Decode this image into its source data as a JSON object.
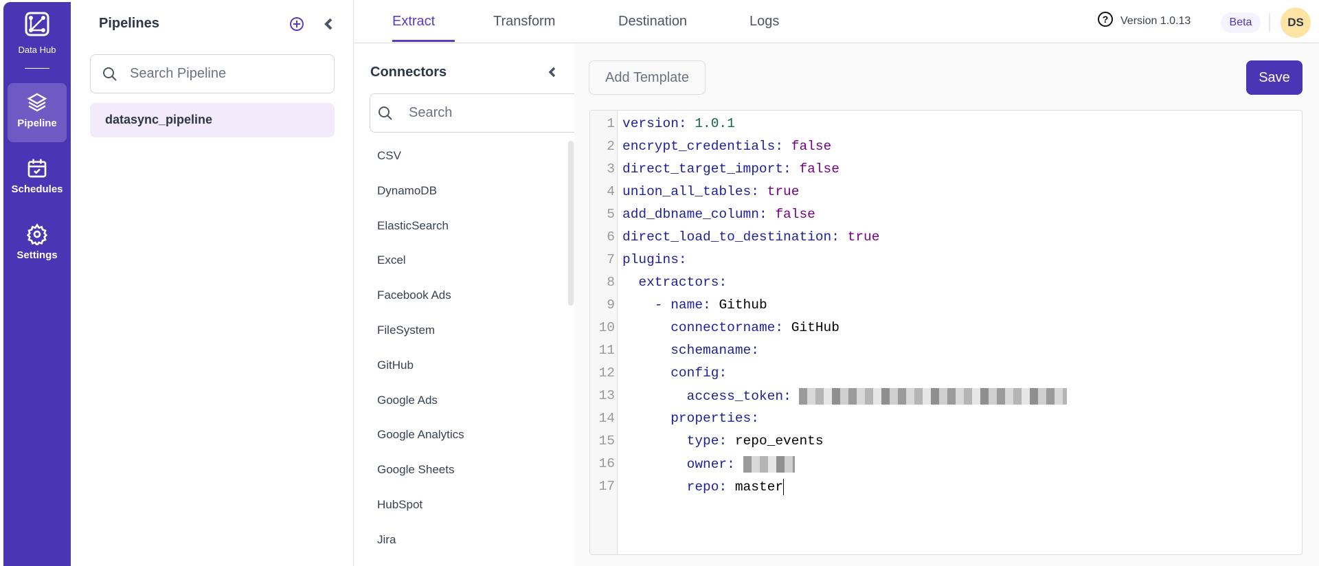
{
  "app": {
    "brand": "Data Hub"
  },
  "rail": [
    {
      "label": "Pipeline",
      "icon": "layers-icon"
    },
    {
      "label": "Schedules",
      "icon": "calendar-check-icon"
    },
    {
      "label": "Settings",
      "icon": "gear-icon"
    }
  ],
  "pipelines": {
    "title": "Pipelines",
    "search_placeholder": "Search Pipeline",
    "items": [
      "datasync_pipeline"
    ]
  },
  "tabs": [
    "Extract",
    "Transform",
    "Destination",
    "Logs"
  ],
  "header": {
    "version": "Version 1.0.13",
    "badge": "Beta",
    "avatar": "DS"
  },
  "connectors": {
    "title": "Connectors",
    "search_placeholder": "Search",
    "items": [
      "CSV",
      "DynamoDB",
      "ElasticSearch",
      "Excel",
      "Facebook Ads",
      "FileSystem",
      "GitHub",
      "Google Ads",
      "Google Analytics",
      "Google Sheets",
      "HubSpot",
      "Jira"
    ]
  },
  "editor": {
    "add_template": "Add Template",
    "save": "Save",
    "lines": [
      {
        "n": "1",
        "indent": "",
        "key": "version",
        "val": "1.0.1",
        "type": "n"
      },
      {
        "n": "2",
        "indent": "",
        "key": "encrypt_credentials",
        "val": "false",
        "type": "b"
      },
      {
        "n": "3",
        "indent": "",
        "key": "direct_target_import",
        "val": "false",
        "type": "b"
      },
      {
        "n": "4",
        "indent": "",
        "key": "union_all_tables",
        "val": "true",
        "type": "b"
      },
      {
        "n": "5",
        "indent": "",
        "key": "add_dbname_column",
        "val": "false",
        "type": "b"
      },
      {
        "n": "6",
        "indent": "",
        "key": "direct_load_to_destination",
        "val": "true",
        "type": "b"
      },
      {
        "n": "7",
        "indent": "",
        "key": "plugins",
        "val": "",
        "type": "v"
      },
      {
        "n": "8",
        "indent": "  ",
        "key": "extractors",
        "val": "",
        "type": "v"
      },
      {
        "n": "9",
        "indent": "    - ",
        "key": "name",
        "val": "Github",
        "type": "v"
      },
      {
        "n": "10",
        "indent": "      ",
        "key": "connectorname",
        "val": "GitHub",
        "type": "v"
      },
      {
        "n": "11",
        "indent": "      ",
        "key": "schemaname",
        "val": "",
        "type": "v"
      },
      {
        "n": "12",
        "indent": "      ",
        "key": "config",
        "val": "",
        "type": "v"
      },
      {
        "n": "13",
        "indent": "        ",
        "key": "access_token",
        "val": "",
        "type": "redacted"
      },
      {
        "n": "14",
        "indent": "      ",
        "key": "properties",
        "val": "",
        "type": "v"
      },
      {
        "n": "15",
        "indent": "        ",
        "key": "type",
        "val": "repo_events",
        "type": "v"
      },
      {
        "n": "16",
        "indent": "        ",
        "key": "owner",
        "val": "",
        "type": "redacted"
      },
      {
        "n": "17",
        "indent": "        ",
        "key": "repo",
        "val": "master",
        "type": "v"
      }
    ]
  }
}
